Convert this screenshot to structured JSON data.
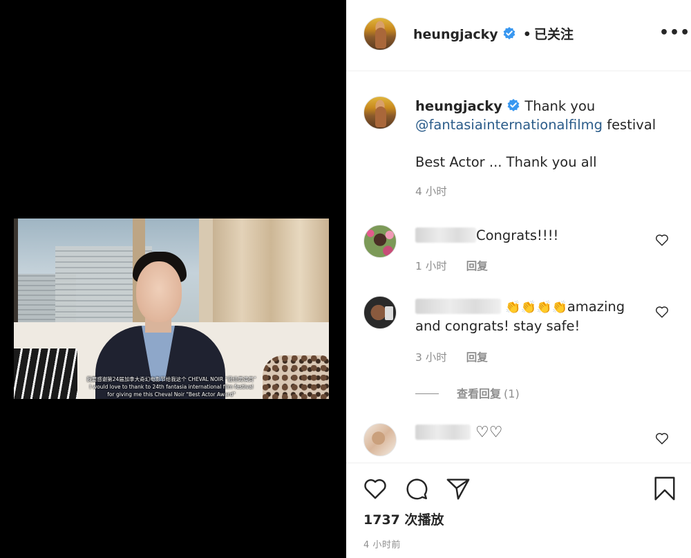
{
  "post": {
    "username": "heungjacky",
    "follow_status": "已关注",
    "separator": "•",
    "more_label": "•••"
  },
  "video": {
    "subtitle_zh": "我要感谢第24届加拿大奇幻电影节给我这个 CHEVAL NOIR “最佳男演员”",
    "subtitle_en_1": "I would love to thank to 24th fantasia international film festival",
    "subtitle_en_2": "for giving me this Cheval Noir \"Best Actor Award\""
  },
  "caption": {
    "username": "heungjacky",
    "text_start": "Thank you",
    "mention": "@fantasiainternationalfilmg",
    "text_end": " festival",
    "line2": "Best Actor ... Thank you all",
    "time": "4 小时"
  },
  "comments": [
    {
      "text": "Congrats!!!!",
      "time": "1 小时",
      "reply_label": "回复"
    },
    {
      "text_after_emoji": "amazing",
      "text_line2": "and congrats! stay safe!",
      "emoji": "👏👏👏👏",
      "time": "3 小时",
      "reply_label": "回复"
    },
    {
      "emoji": "♡♡"
    }
  ],
  "view_replies": {
    "label": "查看回复",
    "count": "(1)"
  },
  "footer": {
    "plays_count": "1737",
    "plays_label": "次播放",
    "posted": "4 小时前"
  },
  "icons": {
    "verified": "verified-badge-icon",
    "like": "heart-icon",
    "comment": "comment-icon",
    "share": "paper-plane-icon",
    "save": "bookmark-icon"
  },
  "colors": {
    "verified": "#3897f0",
    "mention": "#2b5c8a",
    "meta": "#8e8e8e",
    "text": "#262626"
  }
}
